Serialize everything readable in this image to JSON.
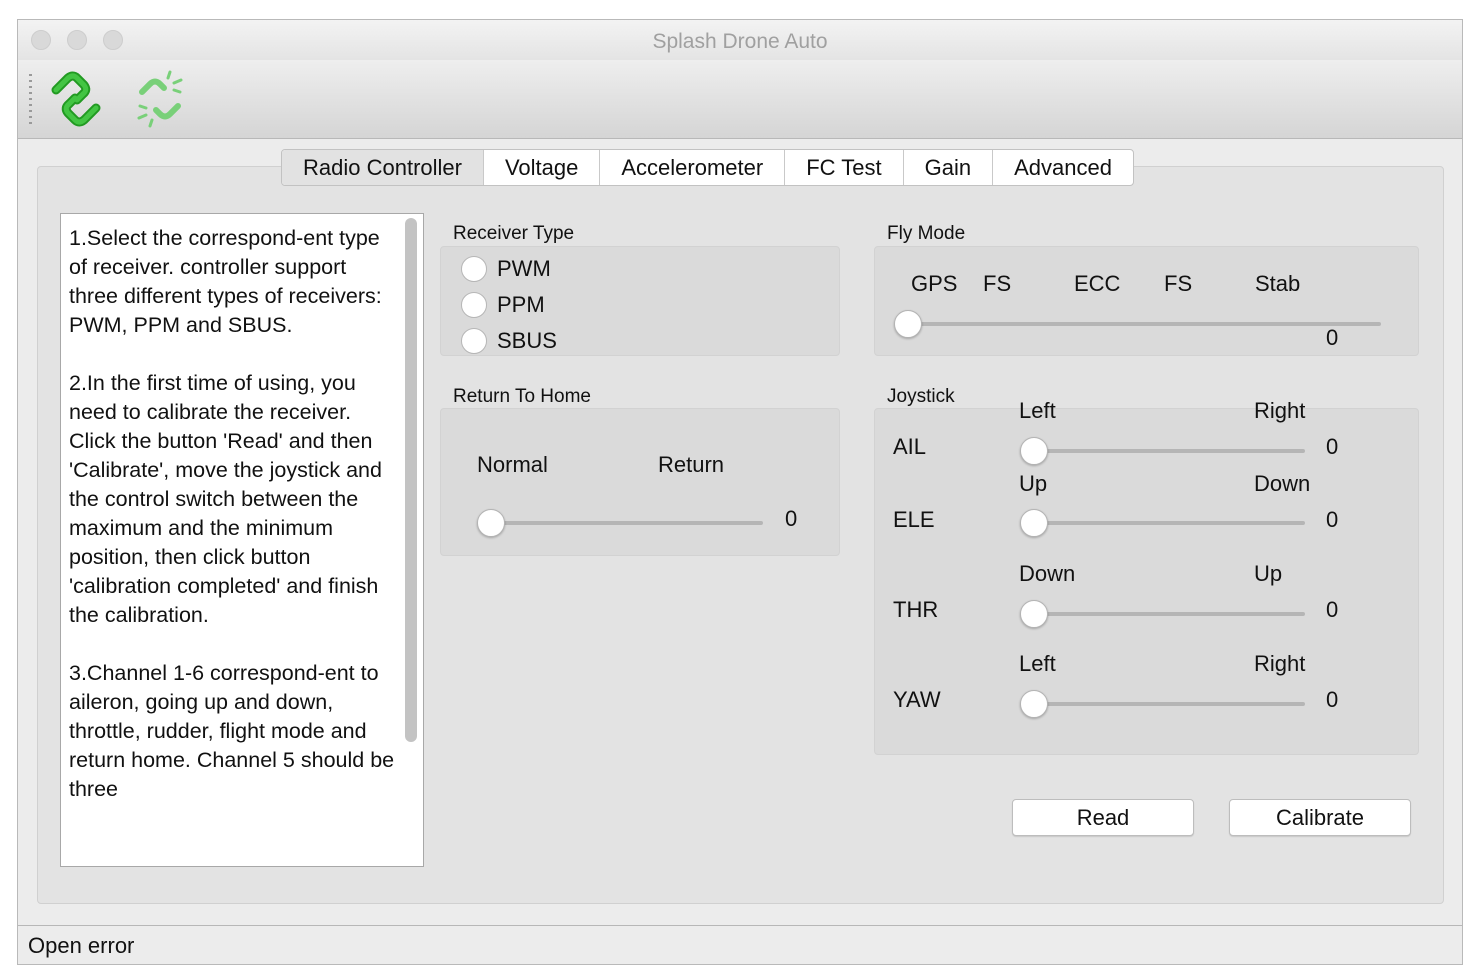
{
  "window": {
    "title": "Splash Drone Auto"
  },
  "toolbar": {
    "connect_icon": "link-icon",
    "disconnect_icon": "broken-link-icon",
    "accent": "#2fb32f"
  },
  "tabs": [
    {
      "label": "Radio Controller",
      "active": true
    },
    {
      "label": "Voltage"
    },
    {
      "label": "Accelerometer"
    },
    {
      "label": "FC Test"
    },
    {
      "label": "Gain"
    },
    {
      "label": "Advanced"
    }
  ],
  "help": {
    "text": "1.Select the correspond-ent type of receiver. controller support three different types of receivers: PWM, PPM and SBUS.\n\n2.In the first time of using, you need to calibrate the receiver.  Click the button 'Read' and then 'Calibrate', move the joystick and the control switch between the maximum and the minimum position, then click button 'calibration completed' and finish the calibration.\n\n3.Channel 1-6 correspond-ent to aileron, going up and down, throttle, rudder, flight mode and return home. Channel 5 should be three"
  },
  "receiver_type": {
    "title": "Receiver Type",
    "options": [
      "PWM",
      "PPM",
      "SBUS"
    ]
  },
  "return_home": {
    "title": "Return To Home",
    "left_label": "Normal",
    "right_label": "Return",
    "value": "0"
  },
  "fly_mode": {
    "title": "Fly Mode",
    "labels": [
      "GPS",
      "FS",
      "ECC",
      "FS",
      "Stab"
    ],
    "value": "0"
  },
  "joystick": {
    "title": "Joystick",
    "channels": [
      {
        "name": "AIL",
        "min_label": "Left",
        "max_label": "Right",
        "value": "0"
      },
      {
        "name": "ELE",
        "min_label": "Up",
        "max_label": "Down",
        "value": "0"
      },
      {
        "name": "THR",
        "min_label": "Down",
        "max_label": "Up",
        "value": "0"
      },
      {
        "name": "YAW",
        "min_label": "Left",
        "max_label": "Right",
        "value": "0"
      }
    ]
  },
  "buttons": {
    "read": "Read",
    "calibrate": "Calibrate"
  },
  "status": {
    "text": "Open error"
  }
}
